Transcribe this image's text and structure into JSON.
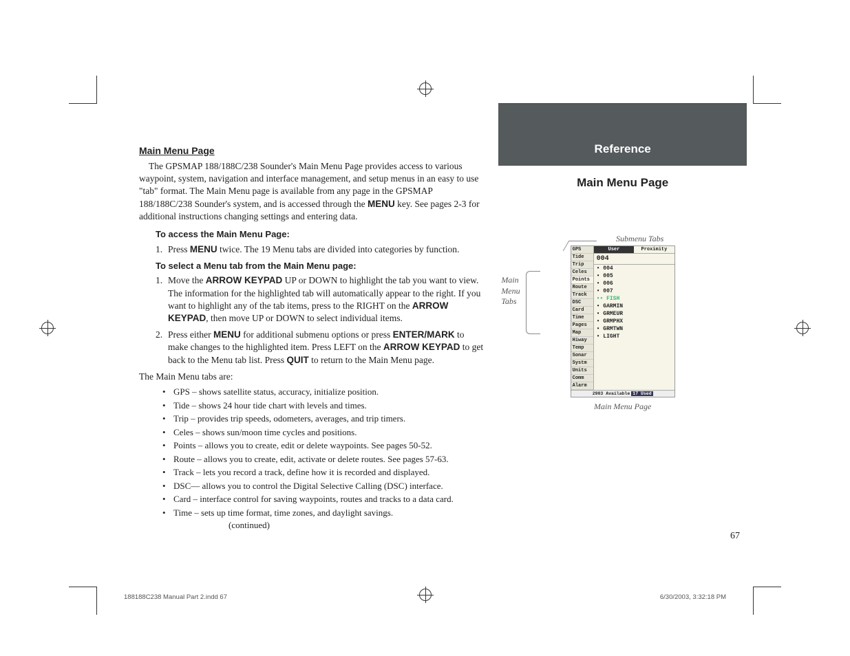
{
  "header": {
    "section_title": "Main Menu Page"
  },
  "para1": "The GPSMAP 188/188C/238 Sounder's Main Menu Page provides access to various waypoint, system, navigation and interface management, and setup menus in an easy to use \"tab\" format. The Main Menu page is available from any page in the GPSMAP 188/188C/238 Sounder's system, and is accessed through the ",
  "para1_bold": "MENU",
  "para1_tail": " key. See pages 2-3 for additional instructions changing settings and entering data.",
  "heading_access": "To access the Main Menu Page:",
  "step_access": {
    "num": "1.",
    "pre": "Press ",
    "b1": "MENU",
    "post": " twice. The 19 Menu tabs are divided into categories by function."
  },
  "heading_select": "To select a Menu tab from the Main Menu page:",
  "step_select1": {
    "num": "1.",
    "t1": "Move the ",
    "b1": "ARROW KEYPAD",
    "t2": " UP or DOWN to highlight the tab you want to view. The information for the highlighted tab will automatically appear to the right. If you want to highlight any of the tab items, press to the RIGHT on the ",
    "b2": "ARROW KEYPAD",
    "t3": ", then move UP or DOWN to select individual items."
  },
  "step_select2": {
    "num": "2.",
    "t1": "Press either ",
    "b1": "MENU",
    "t2": " for additional submenu options or press ",
    "b2": "ENTER/MARK",
    "t3": " to make changes to the highlighted item. Press LEFT on the ",
    "b3": "ARROW KEYPAD",
    "t4": " to get back to the Menu tab list. Press ",
    "b4": "QUIT",
    "t5": " to return to the Main Menu page."
  },
  "tabs_intro": "The Main Menu tabs are:",
  "bullets": [
    "GPS – shows satellite status, accuracy, initialize position.",
    "Tide – shows 24 hour tide chart with levels and times.",
    "Trip – provides trip speeds, odometers, averages, and trip timers.",
    "Celes – shows sun/moon time cycles and positions.",
    "Points – allows you to create, edit or delete waypoints. See pages 50-52.",
    "Route – allows you to create, edit, activate or delete routes. See pages 57-63.",
    "Track – lets you record a track, define how it is recorded and displayed.",
    "DSC— allows you to control the Digital Selective Calling (DSC) interface.",
    "Card – interface control for saving waypoints, routes and tracks to a data card."
  ],
  "last_bullet": "Time – sets up time format, time zones, and daylight savings.",
  "continued": "(continued)",
  "ref_title": "Reference",
  "sub_title": "Main Menu Page",
  "submenu_label": "Submenu Tabs",
  "callout1": "Main",
  "callout2": "Menu",
  "callout3": "Tabs",
  "device": {
    "tabs": [
      "GPS",
      "Tide",
      "Trip",
      "Celes",
      "Points",
      "Route",
      "Track",
      "DSC",
      "Card",
      "Time",
      "Pages",
      "Map",
      "Hiway",
      "Temp",
      "Sonar",
      "Systm",
      "Units",
      "Comm",
      "Alarm"
    ],
    "subtabs": [
      "User",
      "Proximity"
    ],
    "selected_value": "004",
    "items": [
      "004",
      "005",
      "006",
      "007",
      "FISH",
      "GARMIN",
      "GRMEUR",
      "GRMPHX",
      "GRMTWN",
      "LIGHT"
    ],
    "status": "2983 Available",
    "status_used": "17  Used"
  },
  "figure_caption": "Main Menu Page",
  "page_number": "67",
  "footer_left": "188188C238 Manual Part 2.indd   67",
  "footer_right": "6/30/2003, 3:32:18 PM"
}
